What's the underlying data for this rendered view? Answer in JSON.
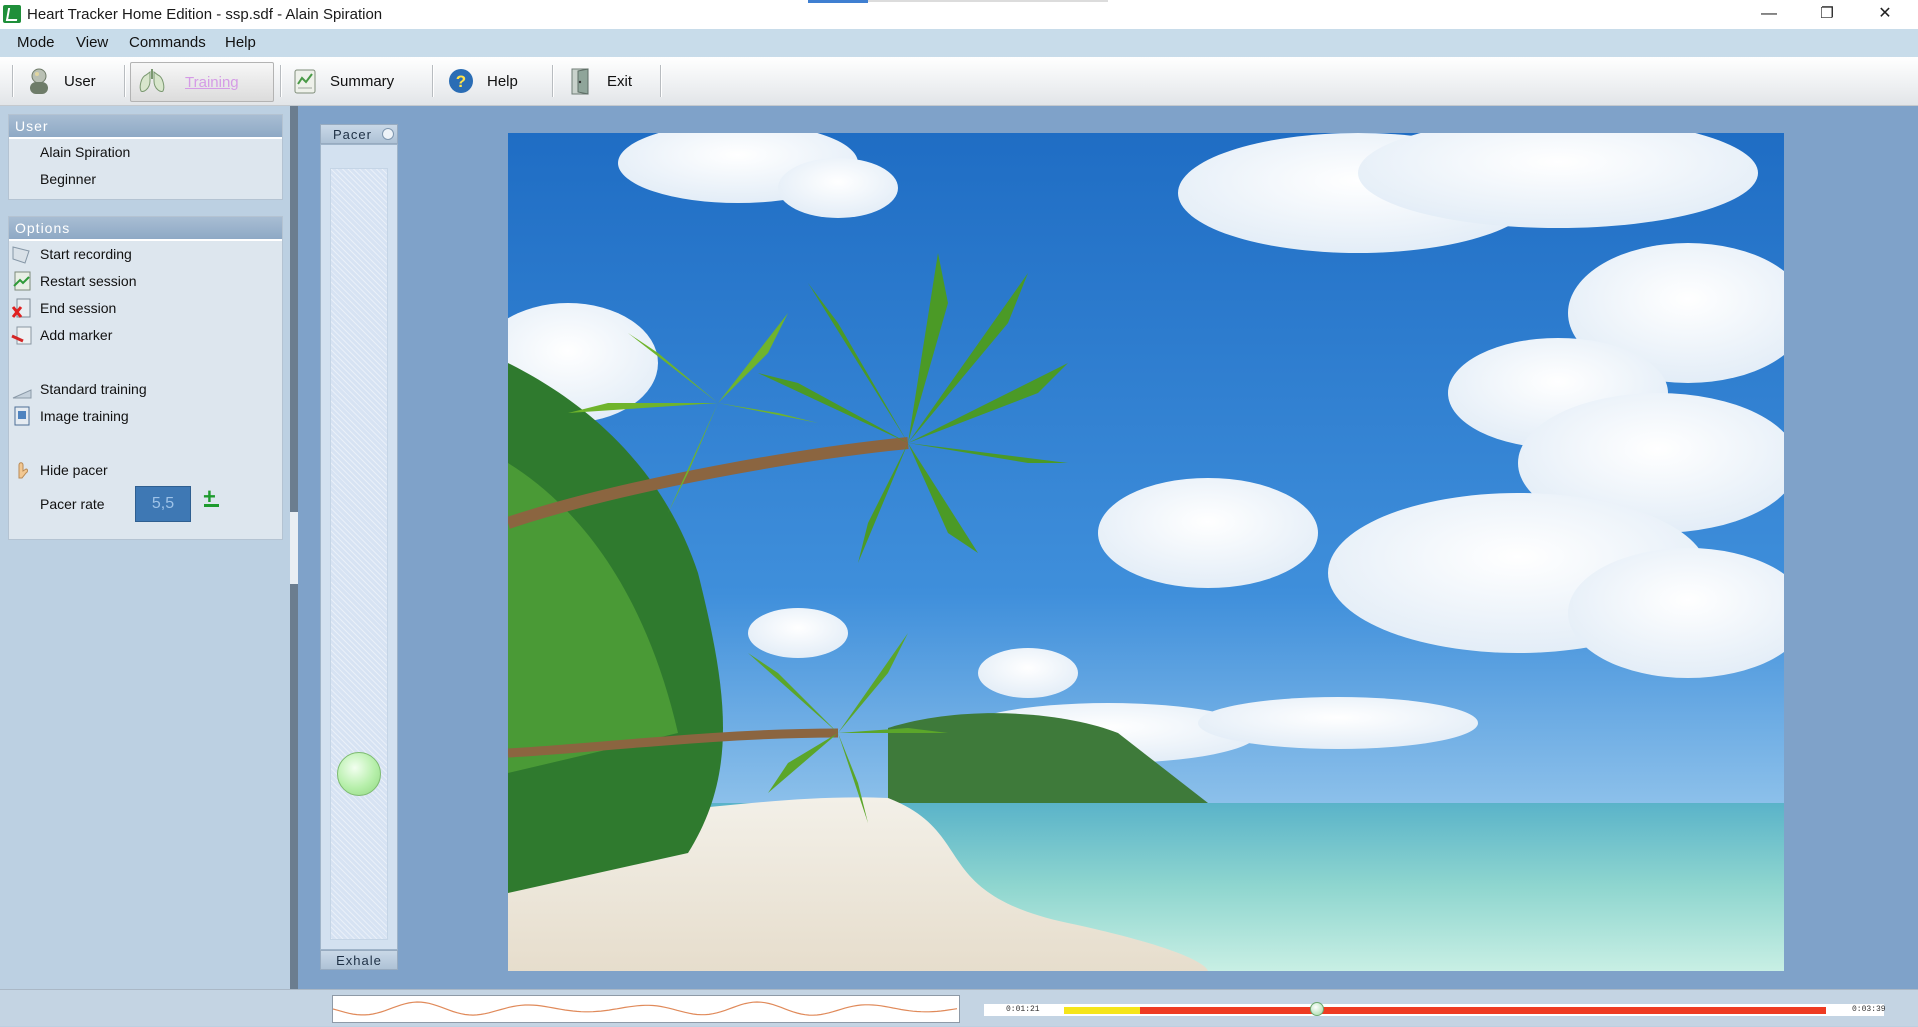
{
  "window": {
    "title": "Heart Tracker Home Edition - ssp.sdf - Alain Spiration",
    "minimize_glyph": "—",
    "restore_glyph": "❐",
    "close_glyph": "✕"
  },
  "menu": [
    "Mode",
    "View",
    "Commands",
    "Help"
  ],
  "toolbar": {
    "user": "User",
    "training": "Training",
    "summary": "Summary",
    "help": "Help",
    "exit": "Exit",
    "active": "training"
  },
  "user_panel": {
    "header": "User",
    "name": "Alain Spiration",
    "level": "Beginner"
  },
  "options_panel": {
    "header": "Options",
    "start_recording": "Start recording",
    "restart_session": "Restart session",
    "end_session": "End session",
    "add_marker": "Add marker",
    "standard_training": "Standard training",
    "image_training": "Image training",
    "hide_pacer": "Hide pacer",
    "pacer_rate_label": "Pacer rate",
    "pacer_rate_value": "5,5"
  },
  "pacer": {
    "title": "Pacer",
    "phase": "Exhale",
    "ball_level": 0.2
  },
  "timeline": {
    "elapsed": "0:01:21",
    "total": "0:03:39",
    "progress": 0.37
  },
  "colors": {
    "timeline_red": "#ee3b22",
    "timeline_yellow": "#f5e51a",
    "pacer_ball": "#b6efaa",
    "content_bg": "#7fa2c9"
  }
}
